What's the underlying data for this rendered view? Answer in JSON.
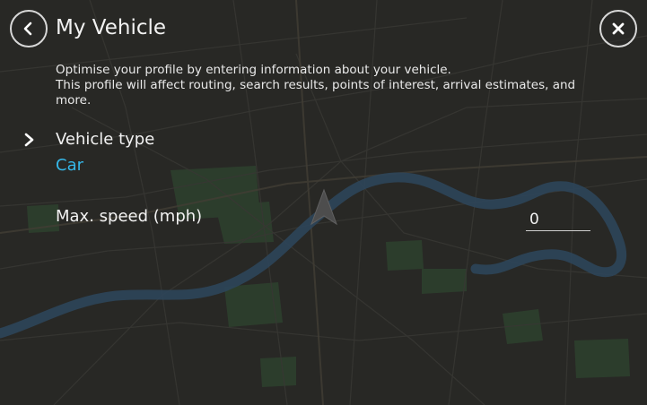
{
  "header": {
    "title": "My Vehicle",
    "back_icon": "chevron-left-icon",
    "close_icon": "close-icon"
  },
  "description": {
    "line1": "Optimise your profile by entering information about your vehicle.",
    "line2": "This profile will affect routing, search results, points of interest, arrival estimates, and more."
  },
  "vehicle_type": {
    "label": "Vehicle type",
    "value": "Car",
    "icon": "chevron-right-icon"
  },
  "max_speed": {
    "label": "Max. speed (mph)",
    "value": "0"
  },
  "colors": {
    "accent": "#35b7e8",
    "text": "#f2f2f2",
    "background": "#31312f",
    "river": "#3a5f7e",
    "park": "#3f5a40"
  }
}
